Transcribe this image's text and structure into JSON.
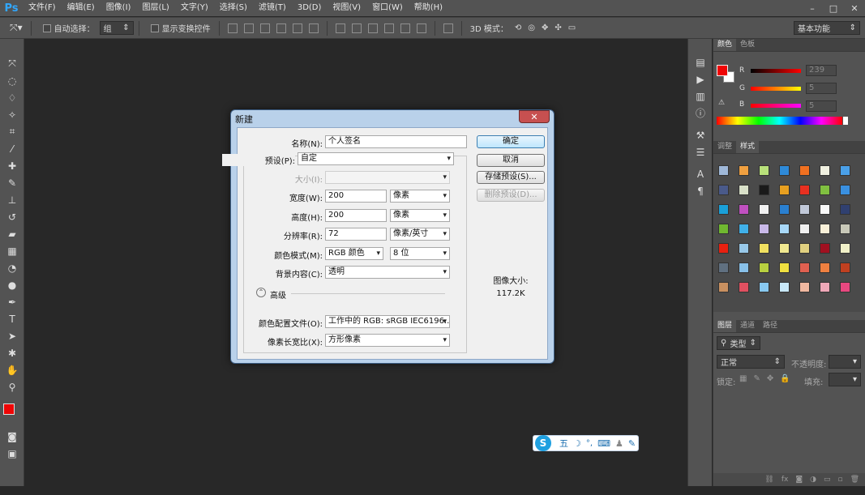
{
  "app": {
    "logo": "Ps"
  },
  "menu": [
    "文件(F)",
    "编辑(E)",
    "图像(I)",
    "图层(L)",
    "文字(Y)",
    "选择(S)",
    "滤镜(T)",
    "3D(D)",
    "视图(V)",
    "窗口(W)",
    "帮助(H)"
  ],
  "window_controls": {
    "minimize": "–",
    "restore": "□",
    "close": "✕"
  },
  "options_bar": {
    "auto_select_label": "自动选择：",
    "auto_select_value": "组",
    "show_transform_label": "显示变换控件",
    "mode_3d_label": "3D 模式：",
    "workspace": "基本功能"
  },
  "color_panel": {
    "tabs": [
      "颜色",
      "色板"
    ],
    "channels": [
      {
        "name": "R",
        "value": "239"
      },
      {
        "name": "G",
        "value": "5"
      },
      {
        "name": "B",
        "value": "5"
      }
    ],
    "foreground": "#ef0505",
    "background": "#ffffff"
  },
  "styles_panel": {
    "tabs": [
      "调整",
      "样式"
    ]
  },
  "layers_panel": {
    "tabs": [
      "图层",
      "通道",
      "路径"
    ],
    "filter_label": "类型",
    "blend_mode": "正常",
    "opacity_label": "不透明度:",
    "lock_label": "锁定:",
    "fill_label": "填充:"
  },
  "dialog": {
    "title": "新建",
    "close": "✕",
    "name_label": "名称(N):",
    "name_value": "个人签名",
    "preset_label": "预设(P):",
    "preset_value": "自定",
    "size_label": "大小(I):",
    "width_label": "宽度(W):",
    "width_value": "200",
    "width_unit": "像素",
    "height_label": "高度(H):",
    "height_value": "200",
    "height_unit": "像素",
    "resolution_label": "分辨率(R):",
    "resolution_value": "72",
    "resolution_unit": "像素/英寸",
    "color_mode_label": "颜色模式(M):",
    "color_mode_value": "RGB 颜色",
    "bit_depth": "8 位",
    "background_label": "背景内容(C):",
    "background_value": "透明",
    "advanced_label": "高级",
    "profile_label": "颜色配置文件(O):",
    "profile_value": "工作中的 RGB: sRGB IEC6196...",
    "aspect_label": "像素长宽比(X):",
    "aspect_value": "方形像素",
    "ok": "确定",
    "cancel": "取消",
    "save_preset": "存储预设(S)...",
    "delete_preset": "删除预设(D)...",
    "image_size_label": "图像大小:",
    "image_size_value": "117.2K"
  },
  "ime": {
    "mode": "五"
  }
}
